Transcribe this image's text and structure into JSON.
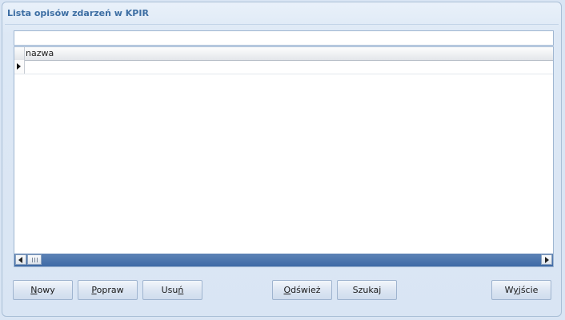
{
  "panel": {
    "title": "Lista opisów zdarzeń w KPIR"
  },
  "search": {
    "value": "",
    "placeholder": ""
  },
  "grid": {
    "columns": [
      "nazwa"
    ],
    "rows": [
      {
        "nazwa": ""
      }
    ]
  },
  "buttons": {
    "new": {
      "key": "N",
      "rest": "owy"
    },
    "edit": {
      "key": "P",
      "rest": "opraw"
    },
    "delete": {
      "pre": "Usu",
      "key": "ń",
      "rest": ""
    },
    "refresh": {
      "key": "O",
      "rest": "dśwież"
    },
    "search": {
      "label": "Szukaj"
    },
    "exit": {
      "pre": "W",
      "key": "y",
      "rest": "jście"
    }
  },
  "icons": {
    "row_indicator": "triangle-right-icon",
    "scroll_left": "arrow-left-icon",
    "scroll_right": "arrow-right-icon"
  }
}
